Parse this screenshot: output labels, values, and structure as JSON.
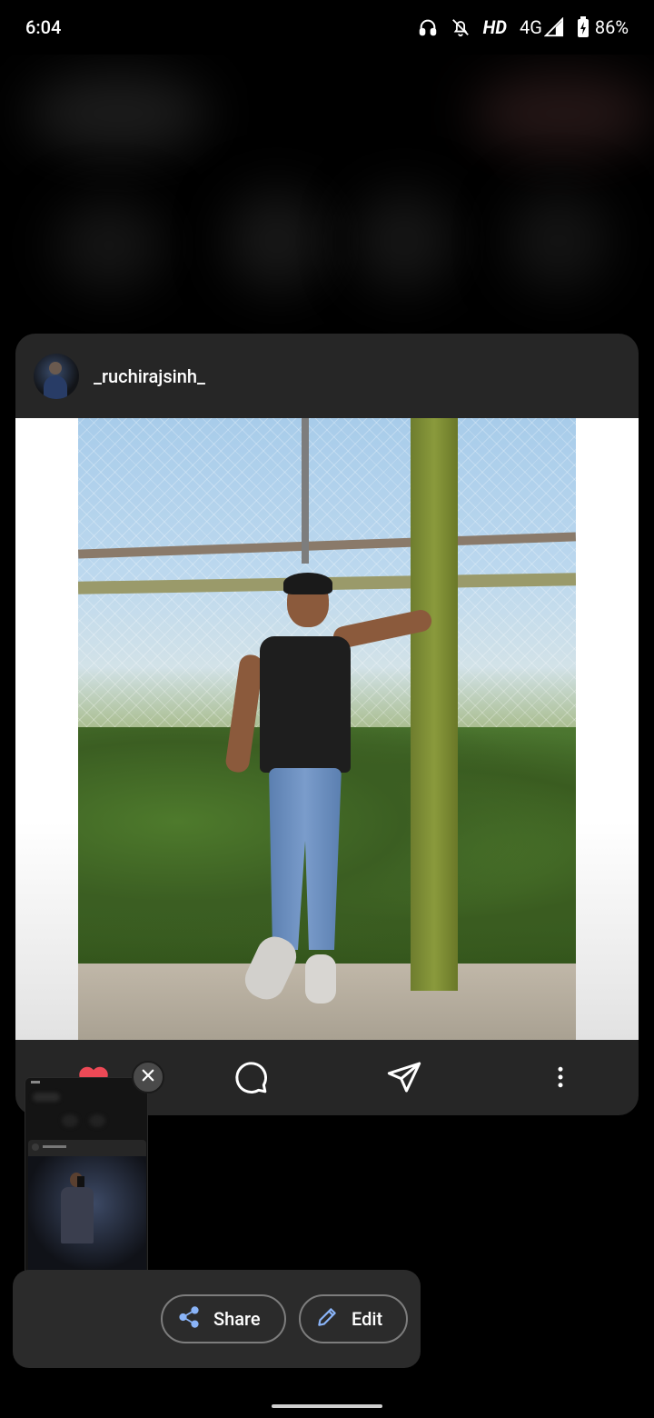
{
  "status_bar": {
    "time": "6:04",
    "hd_label": "HD",
    "network": "4G",
    "battery": "86%",
    "icons": [
      "headphones-icon",
      "bell-off-icon",
      "signal-icon",
      "battery-charging-icon"
    ]
  },
  "post": {
    "username": "_ruchirajsinh_",
    "liked": true,
    "actions": [
      "like-icon",
      "comment-icon",
      "send-icon",
      "more-vert-icon"
    ],
    "like_color": "#ED4956"
  },
  "screenshot_tools": {
    "share_label": "Share",
    "edit_label": "Edit",
    "accent_color": "#8AB4F8"
  }
}
